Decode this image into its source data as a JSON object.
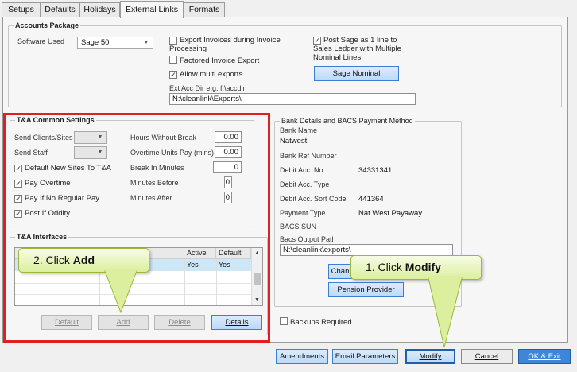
{
  "tabs": [
    "Setups",
    "Defaults",
    "Holidays",
    "External Links",
    "Formats"
  ],
  "active_tab": "External Links",
  "accounts": {
    "title": "Accounts Package",
    "software_label": "Software Used",
    "software_value": "Sage 50",
    "export_invoices": "Export Invoices during Invoice Processing",
    "factored_export": "Factored Invoice Export",
    "allow_multi": "Allow multi exports",
    "post_sage": "Post Sage as 1 line to Sales Ledger with Multiple Nominal Lines.",
    "sage_nominal_btn": "Sage Nominal",
    "ext_dir_label": "Ext Acc Dir e.g. f:\\accdir",
    "ext_dir_value": "N:\\cleanlink\\Exports\\"
  },
  "ta_common": {
    "title": "T&A Common Settings",
    "send_clients": "Send Clients/Sites",
    "send_staff": "Send Staff",
    "default_new_sites": "Default New Sites To T&A",
    "pay_overtime": "Pay Overtime",
    "pay_if_no_regular": "Pay If No Regular Pay",
    "post_if_oddity": "Post If Oddity",
    "hours_without_break_label": "Hours Without Break",
    "hours_without_break_value": "0.00",
    "overtime_units_label": "Overtime Units Pay (mins)",
    "overtime_units_value": "0.00",
    "break_minutes_label": "Break In Minutes",
    "break_minutes_value": "0",
    "minutes_before_label": "Minutes Before",
    "minutes_before_value": "0",
    "minutes_after_label": "Minutes After",
    "minutes_after_value": "0"
  },
  "ta_interfaces": {
    "title": "T&A Interfaces",
    "columns": [
      "Active",
      "Default"
    ],
    "row": [
      "Yes",
      "Yes"
    ],
    "btn_default": "Default",
    "btn_add": "Add",
    "btn_delete": "Delete",
    "btn_details": "Details"
  },
  "bank": {
    "title": "Bank Details and BACS Payment Method",
    "bank_name_label": "Bank Name",
    "bank_name_value": "Natwest",
    "bank_ref_label": "Bank Ref Number",
    "debit_acc_no_label": "Debit Acc. No",
    "debit_acc_no_value": "34331341",
    "debit_acc_type_label": "Debit Acc. Type",
    "sort_code_label": "Debit Acc. Sort Code",
    "sort_code_value": "441364",
    "payment_type_label": "Payment Type",
    "payment_type_value": "Nat West Payaway",
    "bacs_sun_label": "BACS SUN",
    "bacs_path_label": "Bacs Output Path",
    "bacs_path_value": "N:\\cleanlink\\exports\\",
    "change_btn_partial": "Chan",
    "pension_btn": "Pension Provider"
  },
  "backups_required": "Backups Required",
  "footer": {
    "amendments": "Amendments",
    "email_parameters": "Email Parameters",
    "modify": "Modify",
    "cancel": "Cancel",
    "ok_exit": "OK & Exit"
  },
  "callouts": {
    "step2_prefix": "2. Click ",
    "step2_bold": "Add",
    "step1_prefix": "1. Click ",
    "step1_bold": "Modify"
  }
}
